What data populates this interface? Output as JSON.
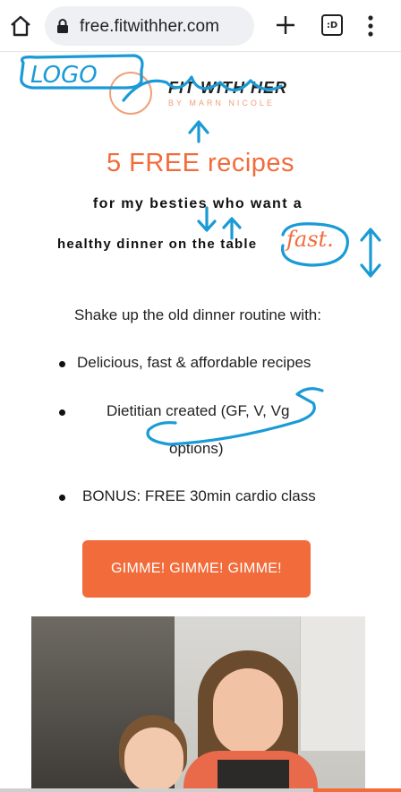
{
  "browser": {
    "url": "free.fitwithher.com",
    "tab_count_label": ":D"
  },
  "logo": {
    "wordmark": "FIT WITH HER",
    "byline": "BY MARN NICOLE"
  },
  "hero": {
    "headline": "5 FREE recipes",
    "subline_1": "for my besties who want a",
    "subline_2": "healthy dinner on the table",
    "emphasis": "fast."
  },
  "intro": "Shake up the old dinner routine with:",
  "bullets": [
    "Delicious, fast & affordable recipes",
    "Dietitian created (GF, V, Vg",
    "options)",
    "BONUS: FREE 30min cardio class"
  ],
  "cta": {
    "label": "GIMME! GIMME! GIMME!"
  },
  "annotations": {
    "logo_note": "LOGO",
    "colors": {
      "ink": "#1a9ad6",
      "accent": "#f26b3a"
    }
  }
}
